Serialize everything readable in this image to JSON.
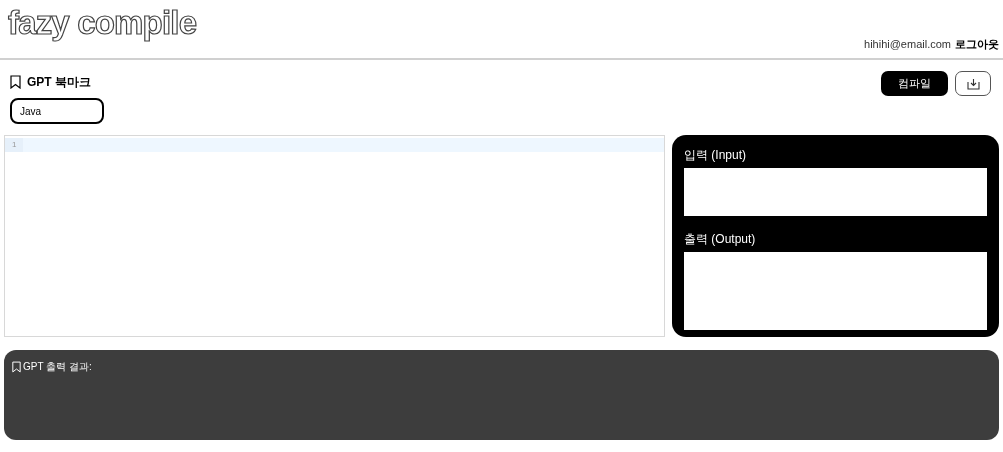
{
  "header": {
    "logo": "fazy compile",
    "email": "hihihi@email.com",
    "logout": "로그아웃"
  },
  "toolbar": {
    "bookmark": "GPT 북마크",
    "compile": "컴파일"
  },
  "language": {
    "value": "Java"
  },
  "editor": {
    "line_numbers": [
      "1"
    ]
  },
  "io": {
    "input_label": "입력 (Input)",
    "output_label": "출력 (Output)"
  },
  "gpt_result": {
    "label": "GPT 출력 결과:"
  }
}
